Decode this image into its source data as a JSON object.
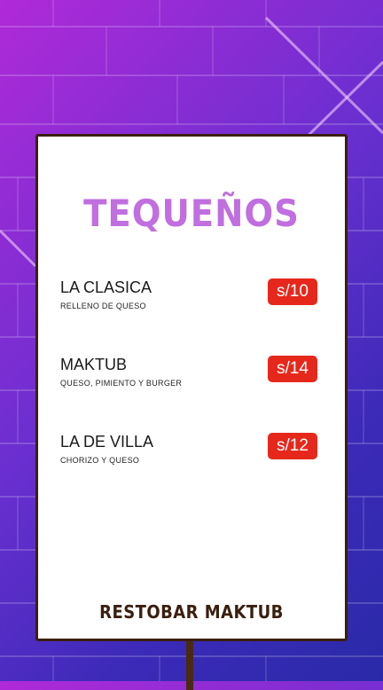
{
  "menu": {
    "title": "TEQUEÑOS",
    "items": [
      {
        "name": "LA CLASICA",
        "description": "RELLENO DE QUESO",
        "price": "s/10"
      },
      {
        "name": "MAKTUB",
        "description": "QUESO, PIMIENTO Y BURGER",
        "price": "s/14"
      },
      {
        "name": "LA DE VILLA",
        "description": "CHORIZO Y QUESO",
        "price": "s/12"
      }
    ],
    "footer": "RESTOBAR MAKTUB"
  },
  "colors": {
    "title": "#c06ee0",
    "price_badge": "#e6281c",
    "board_border": "#3a1f0f",
    "background_top": "#b02ad8",
    "background_bottom": "#2a2aa8"
  }
}
